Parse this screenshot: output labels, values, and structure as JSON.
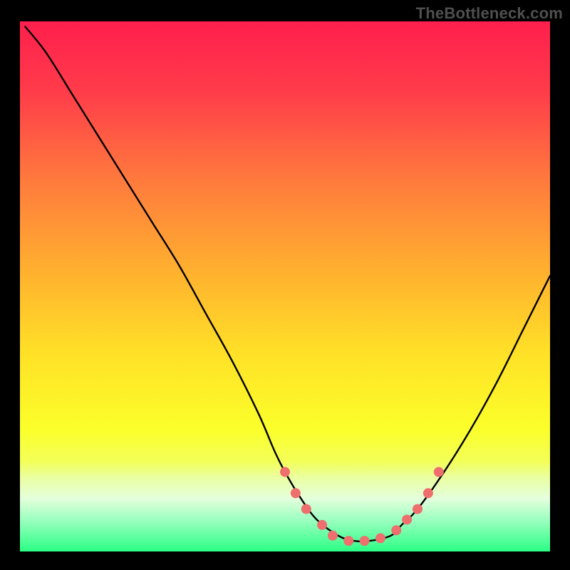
{
  "watermark": "TheBottleneck.com",
  "chart_data": {
    "type": "line",
    "title": "",
    "xlabel": "",
    "ylabel": "",
    "xlim": [
      0,
      100
    ],
    "ylim": [
      0,
      100
    ],
    "grid": false,
    "legend": false,
    "background_gradient": {
      "stops": [
        {
          "offset": 0.0,
          "color": "#ff1f4d"
        },
        {
          "offset": 0.13,
          "color": "#ff3b4a"
        },
        {
          "offset": 0.3,
          "color": "#ff7a3d"
        },
        {
          "offset": 0.48,
          "color": "#ffb32e"
        },
        {
          "offset": 0.63,
          "color": "#ffe227"
        },
        {
          "offset": 0.77,
          "color": "#fbff2a"
        },
        {
          "offset": 0.83,
          "color": "#f3ff58"
        },
        {
          "offset": 0.86,
          "color": "#eaffa0"
        },
        {
          "offset": 0.9,
          "color": "#e4ffdc"
        },
        {
          "offset": 0.94,
          "color": "#9cffc0"
        },
        {
          "offset": 1.0,
          "color": "#2bff85"
        }
      ]
    },
    "series": [
      {
        "name": "bottleneck-curve",
        "color": "#000000",
        "x": [
          1,
          5,
          10,
          15,
          20,
          25,
          30,
          35,
          40,
          45,
          48,
          50,
          53,
          56,
          60,
          63,
          66,
          70,
          72,
          75,
          80,
          85,
          90,
          95,
          100
        ],
        "y": [
          99,
          94,
          86,
          78,
          70,
          62,
          54,
          45,
          36,
          26,
          19,
          15,
          10,
          6,
          3,
          2,
          2,
          3,
          5,
          8,
          15,
          23,
          32,
          42,
          52
        ]
      }
    ],
    "markers": {
      "name": "highlight-points",
      "color": "#ef6e6e",
      "radius": 7,
      "points": [
        {
          "x": 50,
          "y": 15
        },
        {
          "x": 52,
          "y": 11
        },
        {
          "x": 54,
          "y": 8
        },
        {
          "x": 57,
          "y": 5
        },
        {
          "x": 59,
          "y": 3
        },
        {
          "x": 62,
          "y": 2
        },
        {
          "x": 65,
          "y": 2
        },
        {
          "x": 68,
          "y": 2.5
        },
        {
          "x": 71,
          "y": 4
        },
        {
          "x": 73,
          "y": 6
        },
        {
          "x": 75,
          "y": 8
        },
        {
          "x": 77,
          "y": 11
        },
        {
          "x": 79,
          "y": 15
        }
      ]
    }
  }
}
